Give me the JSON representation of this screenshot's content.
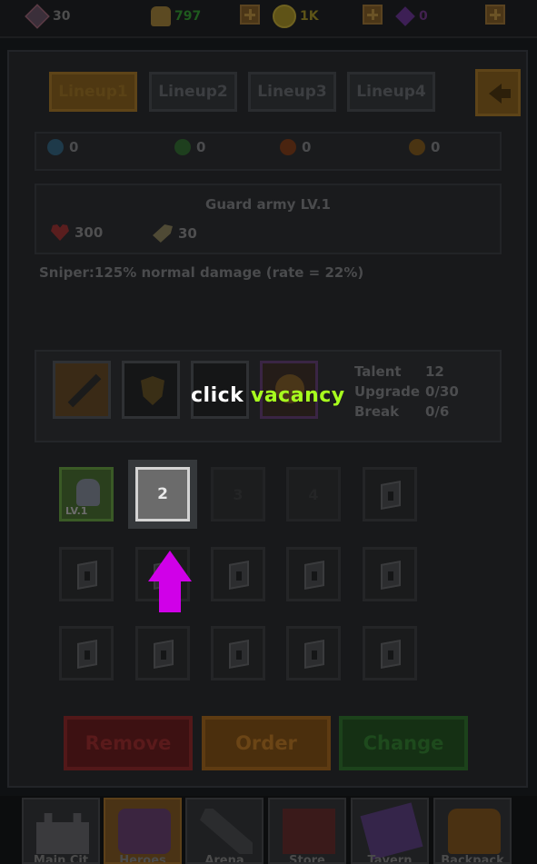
{
  "resources": {
    "gems": "30",
    "food": "797",
    "coins": "1K",
    "crystals": "0"
  },
  "tabs": [
    "Lineup1",
    "Lineup2",
    "Lineup3",
    "Lineup4"
  ],
  "stats": [
    "0",
    "0",
    "0",
    "0"
  ],
  "army": {
    "title": "Guard army  LV.1",
    "hp": "300",
    "attack": "30"
  },
  "skill_desc": "Sniper:125% normal damage (rate = 22%)",
  "talent": {
    "talent_label": "Talent",
    "talent_value": "12",
    "upgrade_label": "Upgrade",
    "upgrade_value": "0/30",
    "break_label": "Break",
    "break_value": "0/6"
  },
  "hint": {
    "click": "click",
    "vacancy": "vacancy"
  },
  "grid": {
    "hero_level": "LV.1",
    "selected_num": "2",
    "slot3": "3",
    "slot4": "4"
  },
  "buttons": {
    "remove": "Remove",
    "order": "Order",
    "change": "Change"
  },
  "nav": [
    "Main Cit",
    "Heroes",
    "Arena",
    "Store",
    "Tavern",
    "Backpack"
  ]
}
